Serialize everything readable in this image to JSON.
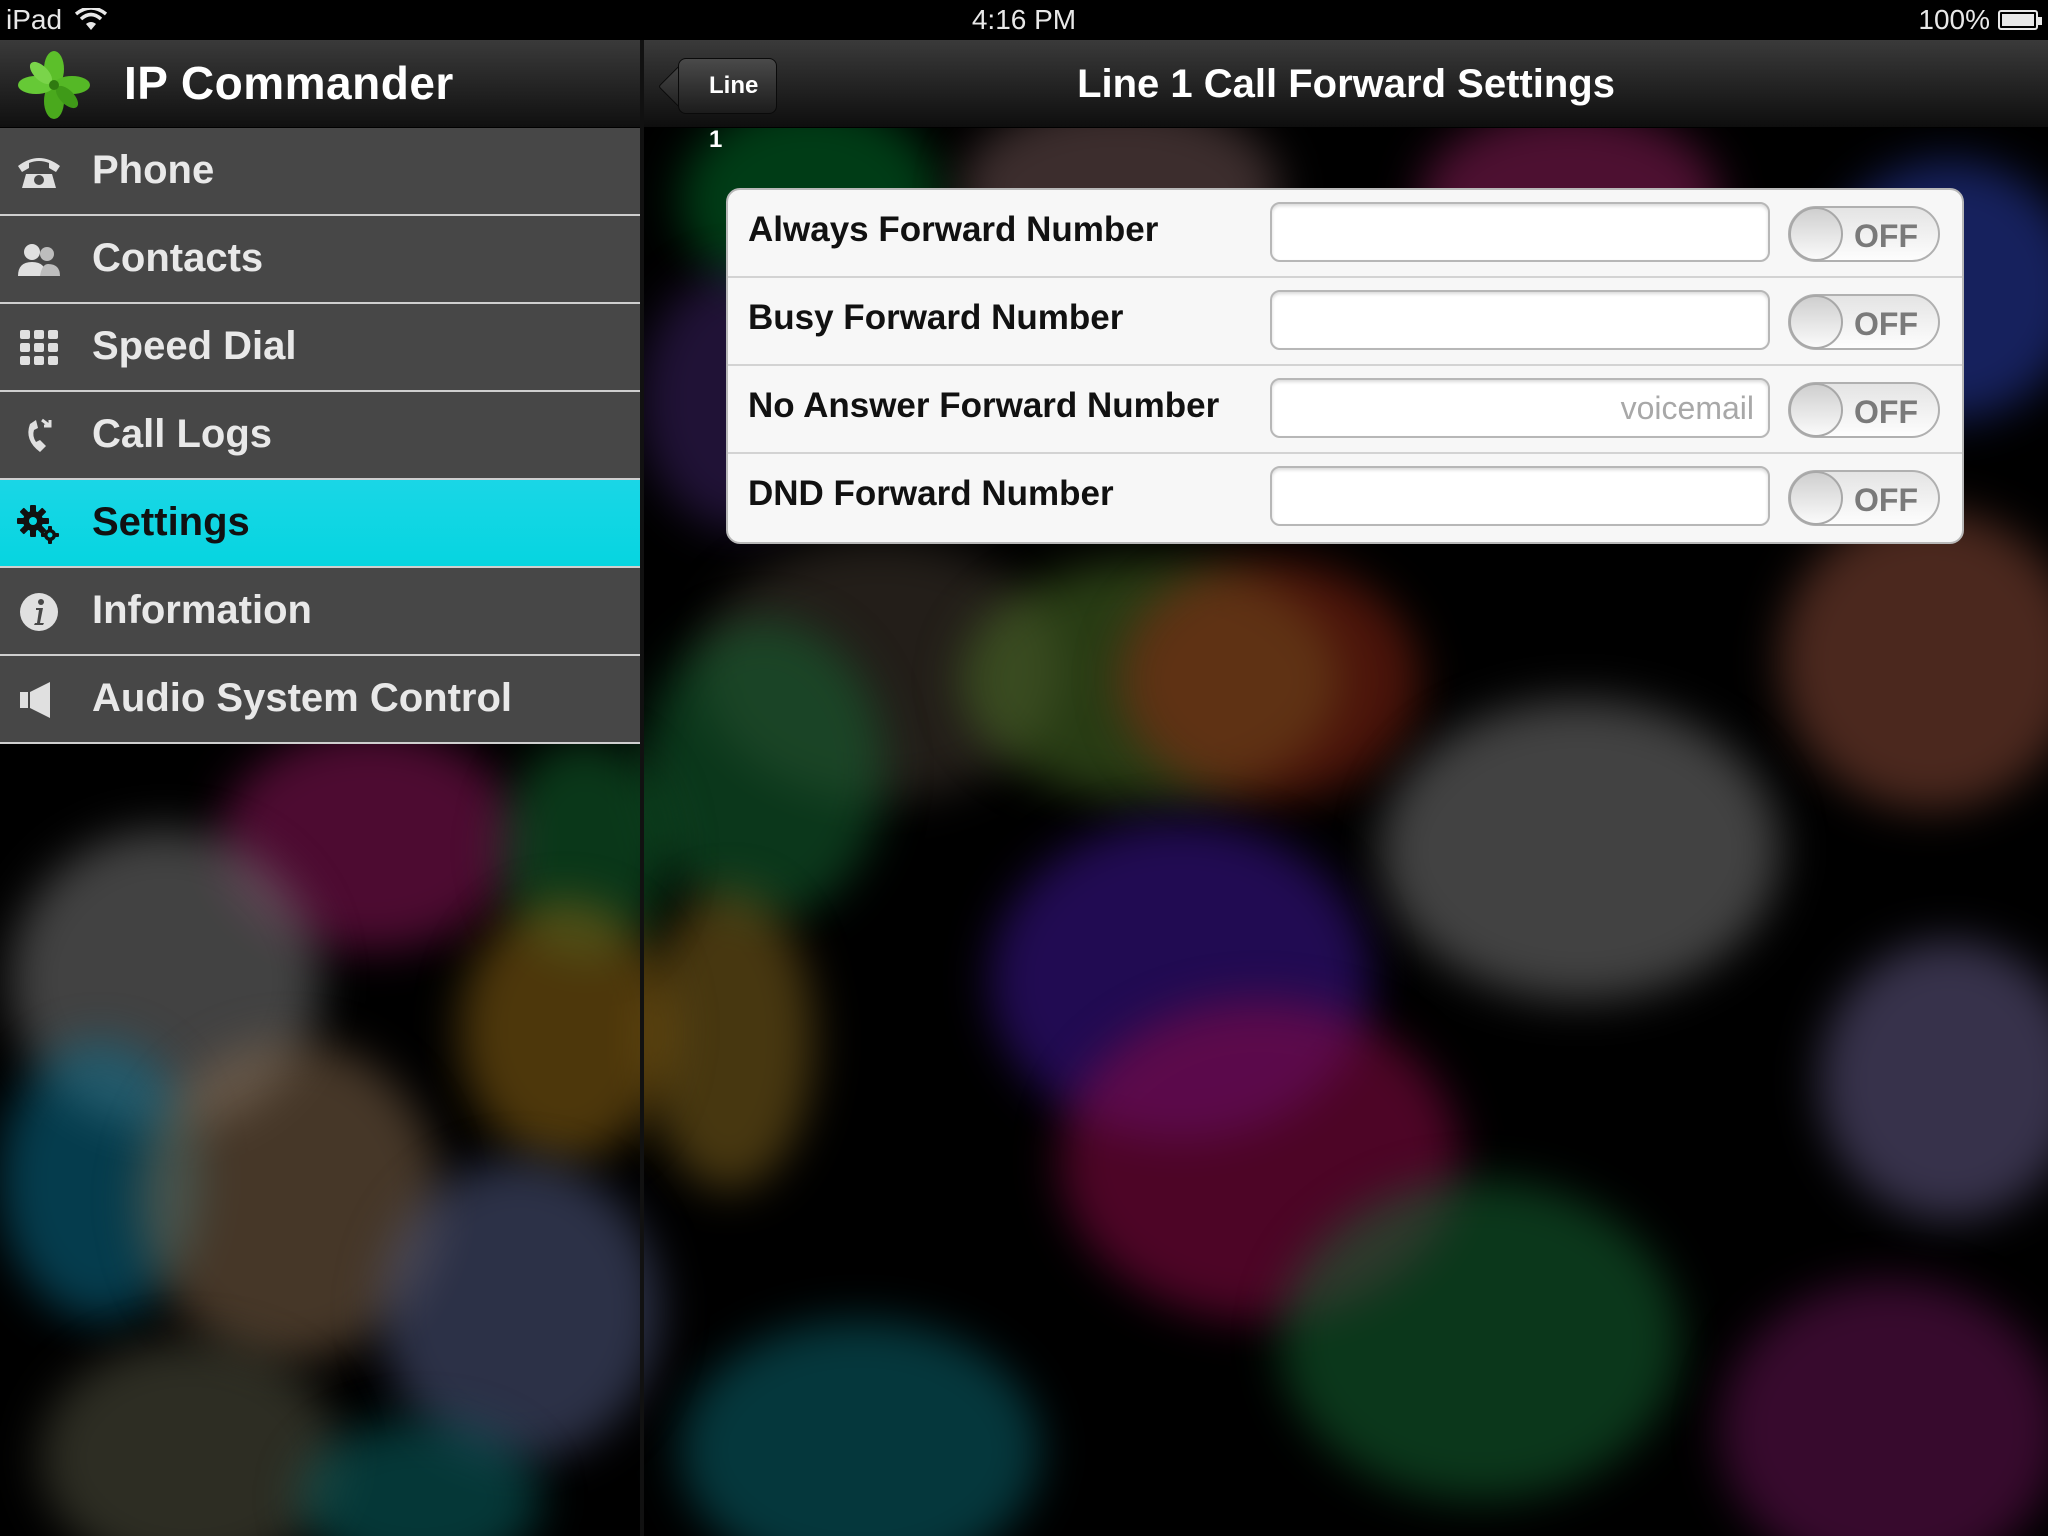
{
  "status_bar": {
    "device": "iPad",
    "time": "4:16 PM",
    "battery": "100%",
    "battery_level": 1.0
  },
  "sidebar": {
    "app_title": "IP Commander",
    "items": [
      {
        "label": "Phone",
        "icon": "phone-icon"
      },
      {
        "label": "Contacts",
        "icon": "contacts-icon"
      },
      {
        "label": "Speed Dial",
        "icon": "keypad-icon"
      },
      {
        "label": "Call Logs",
        "icon": "call-log-icon"
      },
      {
        "label": "Settings",
        "icon": "gear-icon",
        "active": true
      },
      {
        "label": "Information",
        "icon": "info-icon"
      },
      {
        "label": "Audio System Control",
        "icon": "speaker-icon"
      }
    ]
  },
  "navbar": {
    "back_label": "Line 1",
    "title": "Line 1 Call Forward Settings"
  },
  "forward_settings": [
    {
      "label": "Always Forward Number",
      "value": "",
      "placeholder": "",
      "toggle": "OFF"
    },
    {
      "label": "Busy Forward Number",
      "value": "",
      "placeholder": "",
      "toggle": "OFF"
    },
    {
      "label": "No Answer Forward Number",
      "value": "",
      "placeholder": "voicemail",
      "toggle": "OFF"
    },
    {
      "label": "DND Forward Number",
      "value": "",
      "placeholder": "",
      "toggle": "OFF"
    }
  ],
  "colors": {
    "active_item": "#06d5e0",
    "menu_item": "#474747",
    "logo_green": "#5cbf2a"
  }
}
